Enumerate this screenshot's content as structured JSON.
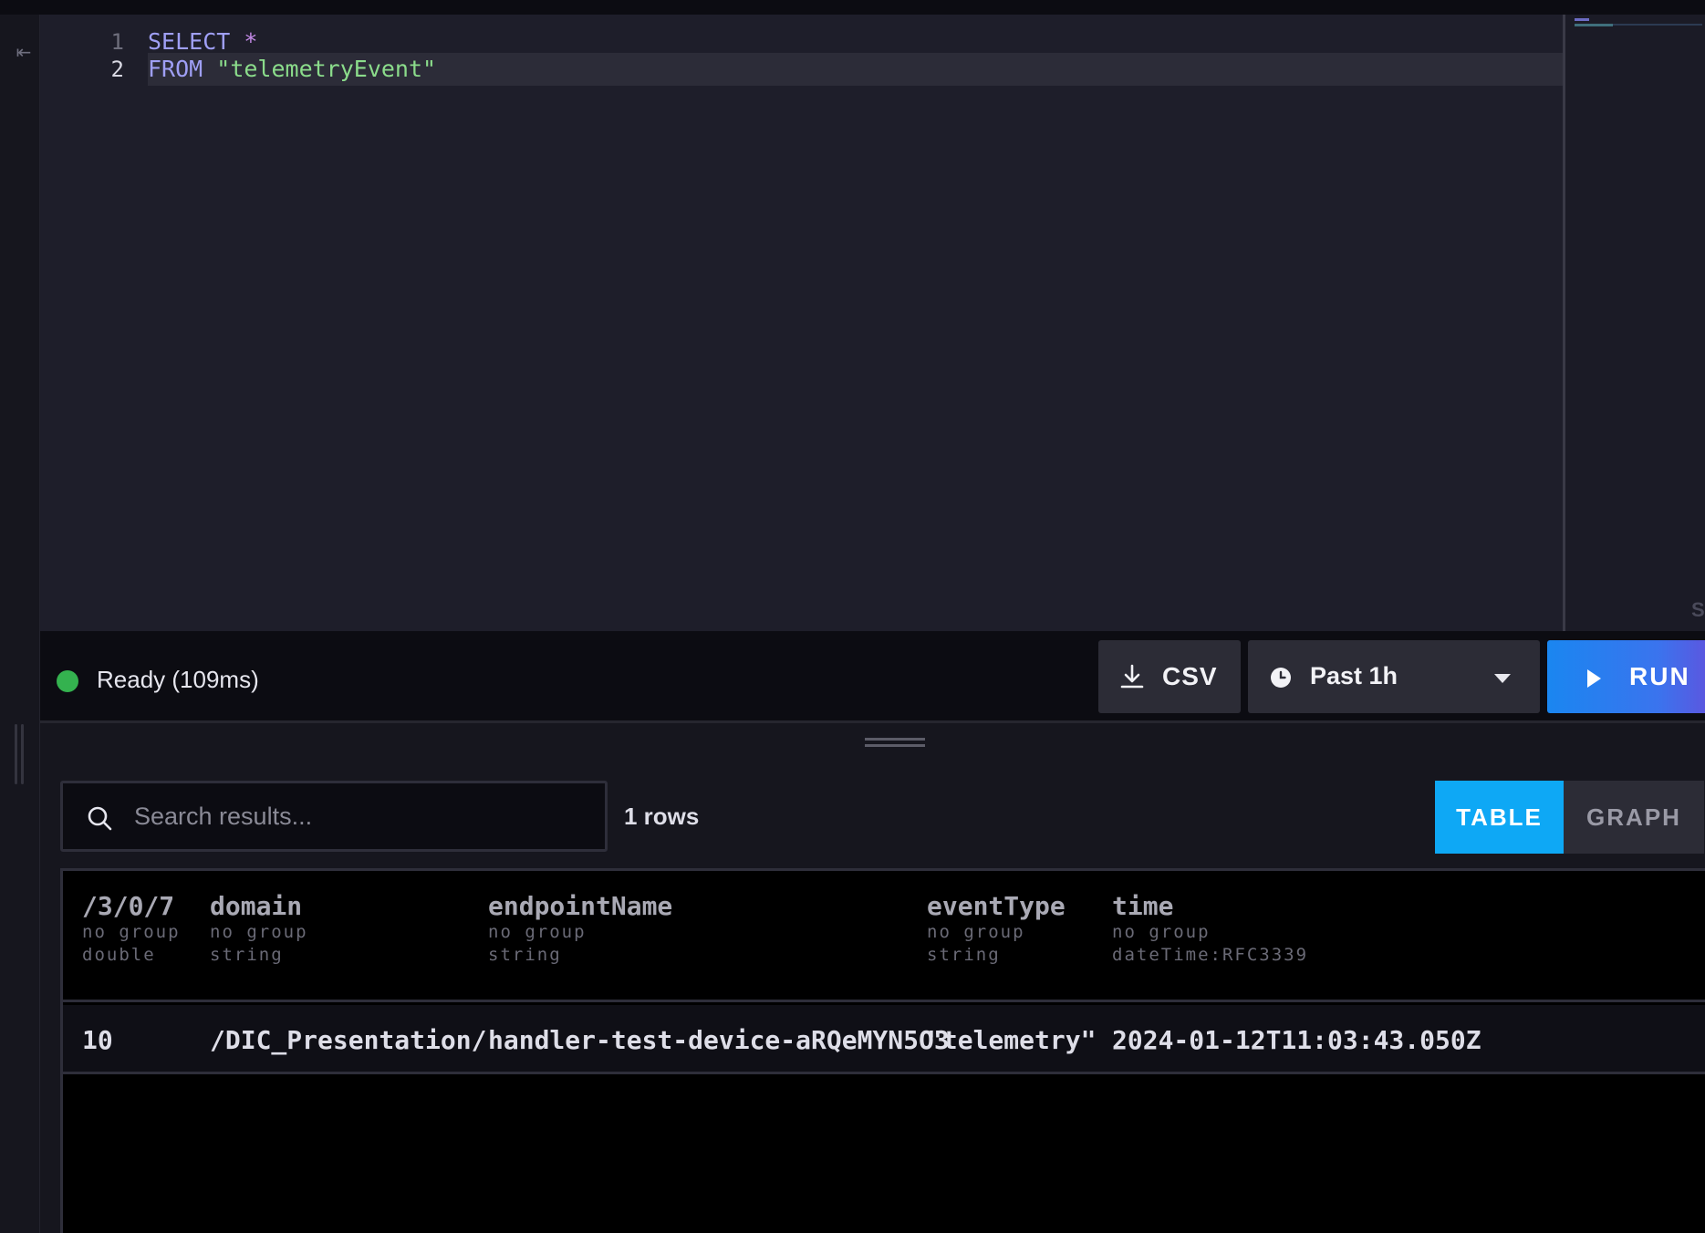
{
  "editor": {
    "lines": [
      {
        "number": "1",
        "keyword": "SELECT",
        "rest": " *"
      },
      {
        "number": "2",
        "keyword": "FROM",
        "rest": " \"telemetryEvent\""
      }
    ]
  },
  "status": {
    "text": "Ready (109ms)",
    "color": "#34b24f"
  },
  "toolbar": {
    "csv_label": "CSV",
    "time_range": "Past 1h",
    "run_label": "RUN"
  },
  "results": {
    "search_placeholder": "Search results...",
    "row_count": "1 rows",
    "tabs": [
      "TABLE",
      "GRAPH"
    ],
    "active_tab": "TABLE",
    "columns": [
      {
        "name": "/3/0/7",
        "group": "no group",
        "type": "double"
      },
      {
        "name": "domain",
        "group": "no group",
        "type": "string"
      },
      {
        "name": "endpointName",
        "group": "no group",
        "type": "string"
      },
      {
        "name": "eventType",
        "group": "no group",
        "type": "string"
      },
      {
        "name": "time",
        "group": "no group",
        "type": "dateTime:RFC3339"
      }
    ],
    "rows": [
      [
        "10",
        "/DIC_Presentation/",
        "handler-test-device-aRQeMYN5O3",
        "\"telemetry\"",
        "2024-01-12T11:03:43.050Z"
      ]
    ]
  },
  "icons": {
    "collapse": "collapse-left-icon",
    "download": "download-icon",
    "clock": "clock-icon",
    "caret": "chevron-down-icon",
    "play": "play-icon",
    "search": "search-icon"
  },
  "colors": {
    "run_button": "#1a86f0",
    "active_tab": "#0ea8f5",
    "keyword": "#9f9ff5",
    "string": "#8bdc8b"
  }
}
